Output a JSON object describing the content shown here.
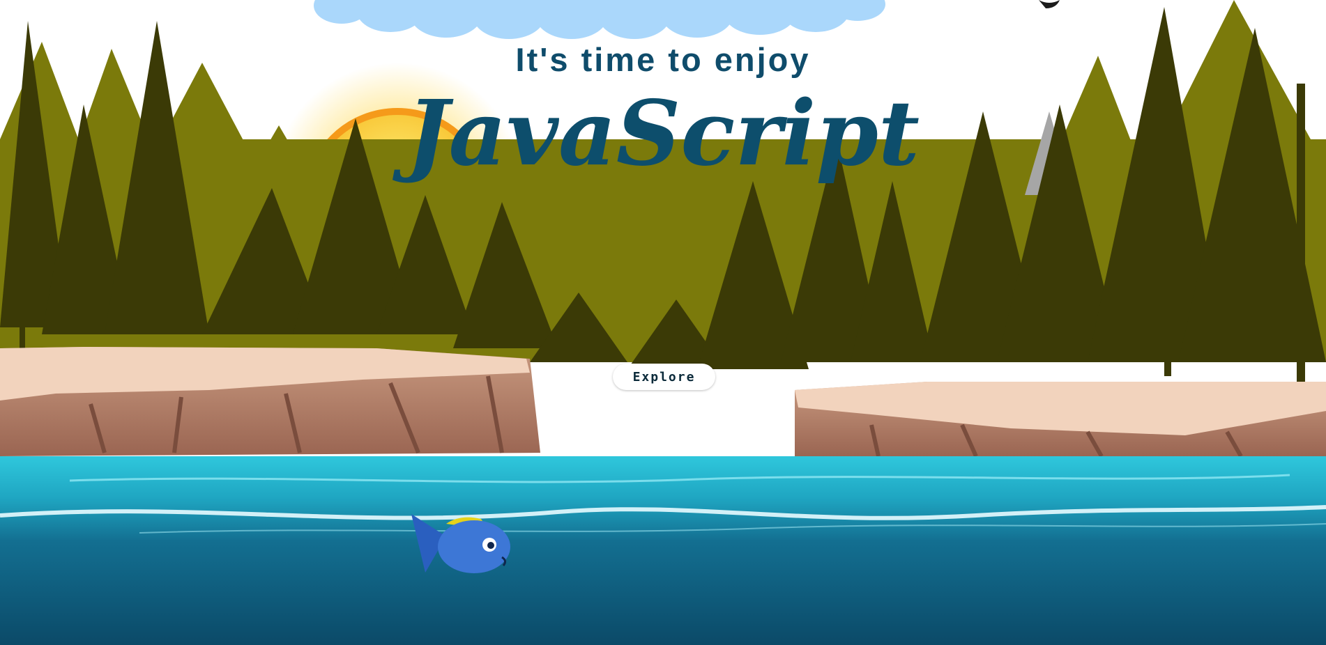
{
  "hero": {
    "subtitle": "It's time to enjoy",
    "title": "JavaScript",
    "cta_label": "Explore"
  },
  "palette": {
    "sky": "#ffffff",
    "cloud": "#a9d6fb",
    "sun": "#ffd21f",
    "forest_dark": "#3a3a06",
    "forest_light": "#7a7a0c",
    "cliff": "#c39277",
    "water_top": "#32c4d8",
    "water_deep": "#0c4d6b",
    "title": "#0d4e6c"
  }
}
